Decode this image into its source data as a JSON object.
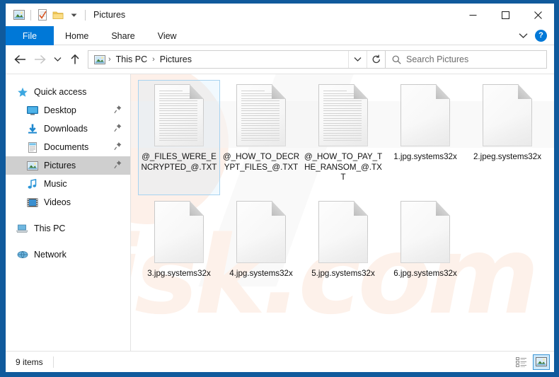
{
  "window": {
    "title": "Pictures",
    "quick_access_icons": [
      "picture-icon",
      "properties-icon",
      "new-folder-icon",
      "customize-dropdown-icon"
    ],
    "controls": {
      "minimize": "—",
      "maximize": "☐",
      "close": "✕"
    }
  },
  "ribbon": {
    "tabs": [
      {
        "label": "File",
        "active": true
      },
      {
        "label": "Home",
        "active": false
      },
      {
        "label": "Share",
        "active": false
      },
      {
        "label": "View",
        "active": false
      }
    ],
    "expand_icon": "chevron-down-icon",
    "help_label": "?"
  },
  "navbar": {
    "back_icon": "←",
    "forward_icon": "→",
    "recent_icon": "˅",
    "up_icon": "↑",
    "breadcrumb": {
      "root_icon": "pictures-icon",
      "items": [
        "This PC",
        "Pictures"
      ],
      "separator": "›"
    },
    "address_dropdown_icon": "chevron-down-icon",
    "refresh_icon": "↻"
  },
  "search": {
    "icon": "search-icon",
    "placeholder": "Search Pictures"
  },
  "sidebar": {
    "items": [
      {
        "label": "Quick access",
        "icon": "star-icon",
        "indent": false,
        "pinned": false,
        "selected": false
      },
      {
        "label": "Desktop",
        "icon": "desktop-icon",
        "indent": true,
        "pinned": true,
        "selected": false
      },
      {
        "label": "Downloads",
        "icon": "downloads-icon",
        "indent": true,
        "pinned": true,
        "selected": false
      },
      {
        "label": "Documents",
        "icon": "documents-icon",
        "indent": true,
        "pinned": true,
        "selected": false
      },
      {
        "label": "Pictures",
        "icon": "pictures-icon",
        "indent": true,
        "pinned": true,
        "selected": true
      },
      {
        "label": "Music",
        "icon": "music-icon",
        "indent": true,
        "pinned": false,
        "selected": false
      },
      {
        "label": "Videos",
        "icon": "videos-icon",
        "indent": true,
        "pinned": false,
        "selected": false
      },
      {
        "label": "This PC",
        "icon": "this-pc-icon",
        "indent": false,
        "pinned": false,
        "selected": false,
        "gap_before": true
      },
      {
        "label": "Network",
        "icon": "network-icon",
        "indent": false,
        "pinned": false,
        "selected": false,
        "gap_before": true
      }
    ]
  },
  "files": [
    {
      "name": "@_FILES_WERE_ENCRYPTED_@.TXT",
      "type": "text",
      "selected": true
    },
    {
      "name": "@_HOW_TO_DECRYPT_FILES_@.TXT",
      "type": "text",
      "selected": false
    },
    {
      "name": "@_HOW_TO_PAY_THE_RANSOM_@.TXT",
      "type": "text",
      "selected": false
    },
    {
      "name": "1.jpg.systems32x",
      "type": "blank",
      "selected": false
    },
    {
      "name": "2.jpeg.systems32x",
      "type": "blank",
      "selected": false
    },
    {
      "name": "3.jpg.systems32x",
      "type": "blank",
      "selected": false
    },
    {
      "name": "4.jpg.systems32x",
      "type": "blank",
      "selected": false
    },
    {
      "name": "5.jpg.systems32x",
      "type": "blank",
      "selected": false
    },
    {
      "name": "6.jpg.systems32x",
      "type": "blank",
      "selected": false
    }
  ],
  "statusbar": {
    "count_label": "9 items",
    "views": [
      {
        "name": "details-view-button",
        "active": false
      },
      {
        "name": "large-icons-view-button",
        "active": true
      }
    ]
  },
  "watermark": {
    "text": "risk.com"
  },
  "colors": {
    "frame_blue": "#105a9c",
    "accent_blue": "#0078d7",
    "selection_border": "#a8d3f0",
    "sidebar_selected": "#cfcfcf",
    "watermark": "#fdf1ea"
  }
}
